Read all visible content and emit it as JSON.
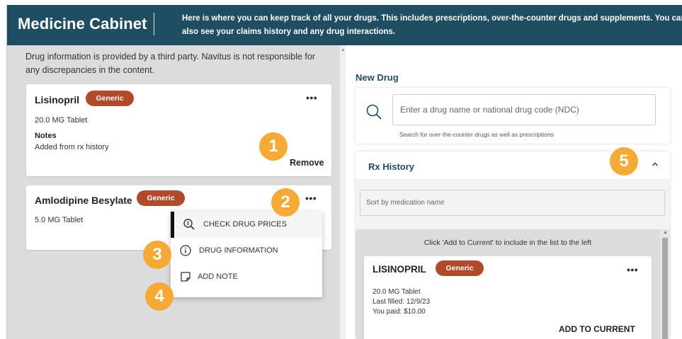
{
  "header": {
    "title": "Medicine Cabinet",
    "description": "Here is where you can keep track of all your drugs. This includes prescriptions, over-the-counter drugs and supplements. You can also see your claims history and any drug interactions.",
    "bg_color": "#1f4e63"
  },
  "left": {
    "disclaimer": "Drug information is provided by a third party. Navitus is not responsible for any discrepancies in the content.",
    "cards": [
      {
        "name": "Lisinopril",
        "badge": "Generic",
        "dose": "20.0 MG Tablet",
        "notes_label": "Notes",
        "notes_text": "Added from rx history",
        "remove_label": "Remove",
        "more_icon": "more-horizontal-icon"
      },
      {
        "name": "Amlodipine Besylate",
        "badge": "Generic",
        "dose": "5.0 MG Tablet",
        "more_icon": "more-horizontal-icon"
      }
    ]
  },
  "menu": {
    "items": [
      {
        "label": "CHECK DRUG PRICES",
        "icon": "price-search-icon",
        "active": true
      },
      {
        "label": "DRUG INFORMATION",
        "icon": "info-icon",
        "active": false
      },
      {
        "label": "ADD NOTE",
        "icon": "note-icon",
        "active": false
      }
    ]
  },
  "markers": [
    "1",
    "2",
    "3",
    "4",
    "5"
  ],
  "right": {
    "new_drug_title": "New Drug",
    "search_placeholder": "Enter a drug name or national drug code (NDC)",
    "search_hint": "Search for over-the-counter drugs as well as prescriptions",
    "rx_history_title": "Rx History",
    "sort_placeholder": "Sort by medication name",
    "list_note": "Click 'Add to Current' to include in the list to the left",
    "rx_item": {
      "name": "LISINOPRIL",
      "badge": "Generic",
      "dose": "20.0 MG Tablet",
      "last_filled": "Last filled: 12/9/23",
      "you_paid": "You paid: $10.00",
      "add_label": "ADD TO CURRENT"
    }
  },
  "colors": {
    "badge": "#b14a28",
    "marker": "#f7a935",
    "accent_text": "#1f4e63"
  }
}
